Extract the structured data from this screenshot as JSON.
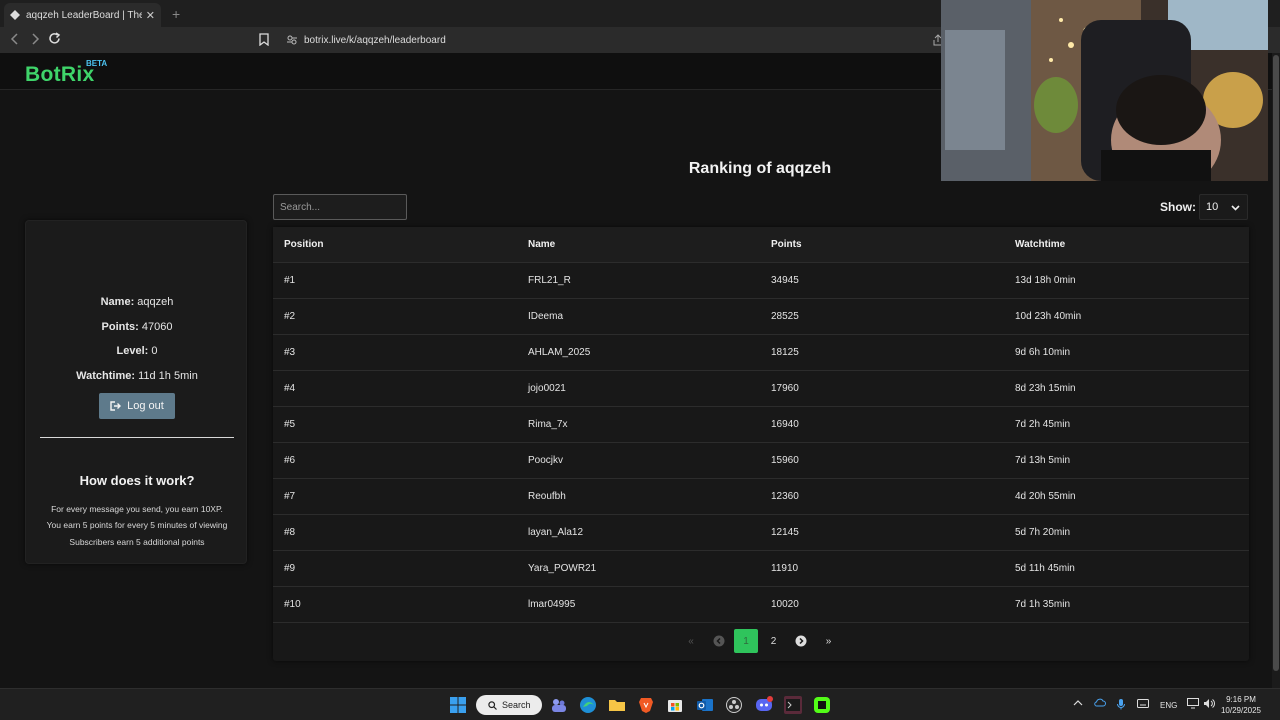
{
  "browser": {
    "tab_title": "aqqzeh LeaderBoard | The best c",
    "new_tab": "+",
    "tab_close": "✕",
    "url": "botrix.live/k/aqqzeh/leaderboard"
  },
  "site": {
    "logo": "BotRix",
    "badge": "BETA",
    "brand_color": "#3fd46a"
  },
  "page": {
    "title": "Ranking of aqqzeh"
  },
  "profile": {
    "name_label": "Name:",
    "name_value": "aqqzeh",
    "points_label": "Points:",
    "points_value": "47060",
    "level_label": "Level:",
    "level_value": "0",
    "watchtime_label": "Watchtime:",
    "watchtime_value": "11d 1h 5min",
    "logout_label": "Log out"
  },
  "how": {
    "title": "How does it work?",
    "lines": [
      "For every message you send, you earn 10XP.",
      "You earn 5 points for every 5 minutes of viewing",
      "Subscribers earn 5 additional points"
    ]
  },
  "controls": {
    "search_placeholder": "Search...",
    "show_label": "Show:",
    "show_value": "10"
  },
  "table": {
    "headers": [
      "Position",
      "Name",
      "Points",
      "Watchtime"
    ],
    "rows": [
      [
        "#1",
        "FRL21_R",
        "34945",
        "13d 18h 0min"
      ],
      [
        "#2",
        "IDeema",
        "28525",
        "10d 23h 40min"
      ],
      [
        "#3",
        "AHLAM_2025",
        "18125",
        "9d 6h 10min"
      ],
      [
        "#4",
        "jojo0021",
        "17960",
        "8d 23h 15min"
      ],
      [
        "#5",
        "Rima_7x",
        "16940",
        "7d 2h 45min"
      ],
      [
        "#6",
        "Poocjkv",
        "15960",
        "7d 13h 5min"
      ],
      [
        "#7",
        "Reoufbh",
        "12360",
        "4d 20h 55min"
      ],
      [
        "#8",
        "layan_Ala12",
        "12145",
        "5d 7h 20min"
      ],
      [
        "#9",
        "Yara_POWR21",
        "11910",
        "5d 11h 45min"
      ],
      [
        "#10",
        "lmar04995",
        "10020",
        "7d 1h 35min"
      ]
    ]
  },
  "pagination": {
    "first": "«",
    "prev": "‹",
    "pages": [
      "1",
      "2"
    ],
    "current": "1",
    "next": "›",
    "last": "»"
  },
  "taskbar": {
    "search_label": "Search",
    "lang": "ENG",
    "time": "9:16 PM",
    "date": "10/29/2025"
  }
}
